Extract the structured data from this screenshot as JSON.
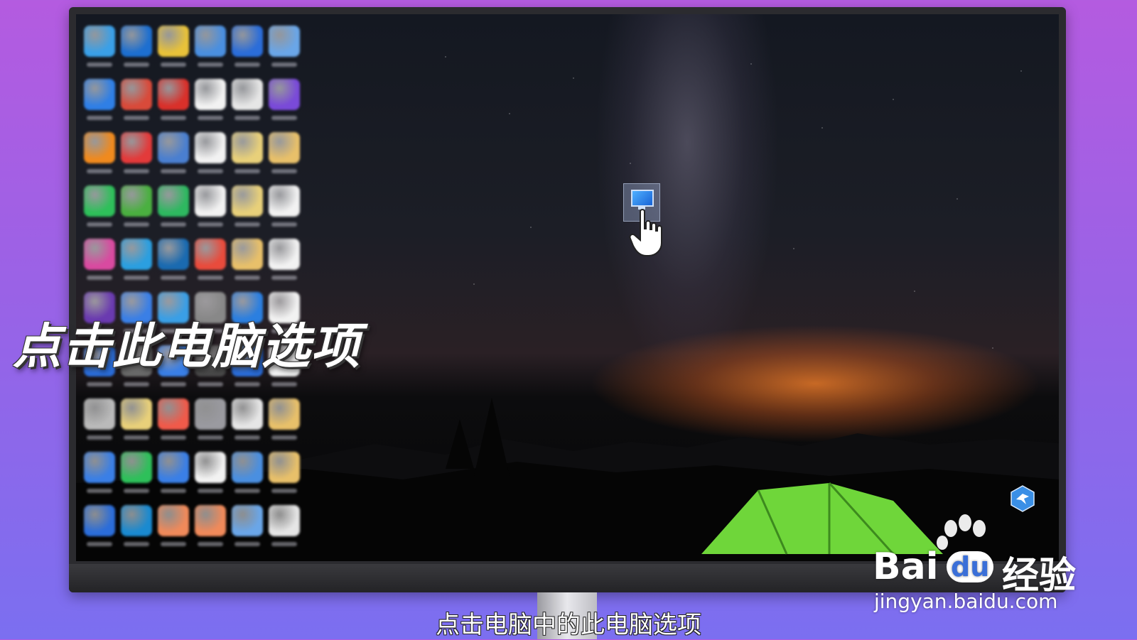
{
  "overlay_title": "点击此电脑选项",
  "subtitle": "点击电脑中的此电脑选项",
  "watermark": {
    "brand_left": "Bai",
    "brand_mid": "du",
    "brand_right": "经验",
    "url": "jingyan.baidu.com"
  },
  "desktop": {
    "highlighted_icon": "this-pc-icon",
    "icon_colors": [
      "#3aa0e8",
      "#1d6fd0",
      "#e8c23a",
      "#4a8fe0",
      "#2b6dd9",
      "#6aa6e8",
      "#2f7fe6",
      "#d94a3a",
      "#d9302a",
      "#f2f2f2",
      "#e6e6e6",
      "#7a4ad9",
      "#f08a1e",
      "#e33a3a",
      "#4a7fd0",
      "#f2f2f2",
      "#e8d07a",
      "#e8c06a",
      "#2ec05a",
      "#4ab040",
      "#2eb860",
      "#f2f2f2",
      "#e8d07a",
      "#f2f2f2",
      "#d94aa0",
      "#2b9fe0",
      "#1a6ab0",
      "#e94b3c",
      "#e8c06a",
      "#f2f2f2",
      "#6a3ab0",
      "#3a7fe6",
      "#3a9fe6",
      "#888888",
      "#2b7fe0",
      "#f2f2f2",
      "#2b6dd9",
      "#6a6a6a",
      "#3a7fe6",
      "#4a4a4a",
      "#2b6dd9",
      "#f2f2f2",
      "#bababa",
      "#e8d07a",
      "#f05a4a",
      "#9a9aa0",
      "#e6e6e6",
      "#e8c06a",
      "#3a7fe6",
      "#2ec05a",
      "#3a7fe6",
      "#f2f2f2",
      "#4a8fe0",
      "#e8c06a",
      "#2b6dd9",
      "#1a8ad0",
      "#f08a5a",
      "#f08a5a",
      "#6aa6e8",
      "#e6e6e6"
    ]
  },
  "colors": {
    "background_top": "#b45be0",
    "background_bottom": "#7b6ff0",
    "tent_green": "#6fd63a",
    "tray_icon_blue": "#3a8fe6"
  }
}
